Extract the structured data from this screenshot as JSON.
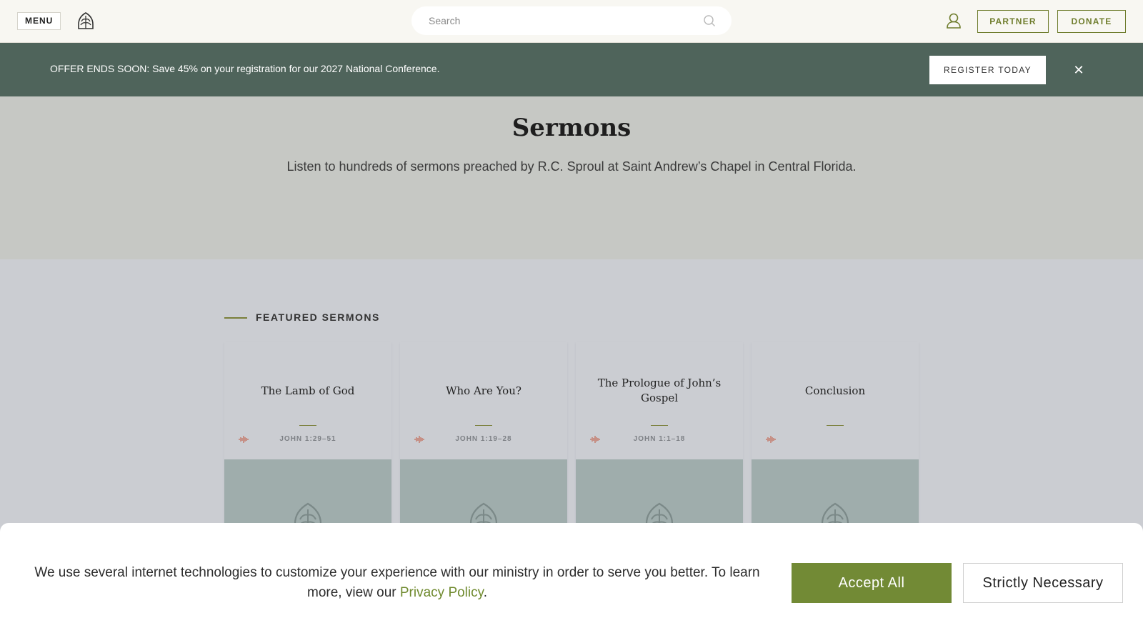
{
  "header": {
    "menu_label": "MENU",
    "logo_icon": "leaf-shield-icon",
    "search_placeholder": "Search",
    "search_icon": "search-icon",
    "user_icon": "user-icon",
    "partner_label": "PARTNER",
    "donate_label": "DONATE"
  },
  "promo": {
    "text": "OFFER ENDS SOON: Save 45% on your registration for our 2027 National Conference.",
    "register_label": "REGISTER TODAY",
    "close_icon": "close-icon",
    "close_glyph": "✕"
  },
  "hero": {
    "title": "Sermons",
    "subtitle": "Listen to hundreds of sermons preached by R.C. Sproul at Saint Andrew’s Chapel in Central Florida."
  },
  "featured": {
    "heading": "FEATURED SERMONS",
    "cards": [
      {
        "title": "The Lamb of God",
        "reference": "JOHN 1:29–51",
        "audio_icon": "audio-wave-icon"
      },
      {
        "title": "Who Are You?",
        "reference": "JOHN 1:19–28",
        "audio_icon": "audio-wave-icon"
      },
      {
        "title": "The Prologue of John’s Gospel",
        "reference": "JOHN 1:1–18",
        "audio_icon": "audio-wave-icon"
      },
      {
        "title": "Conclusion",
        "reference": "",
        "audio_icon": "audio-wave-icon"
      }
    ]
  },
  "cookie": {
    "text_before": "We use several internet technologies to customize your experience with our ministry in order to serve you better. To learn more, view our ",
    "link_text": "Privacy Policy",
    "text_after": ".",
    "accept_label": "Accept All",
    "necessary_label": "Strictly Necessary"
  },
  "colors": {
    "accent_olive": "#728a35",
    "banner_green": "#4f645b",
    "hero_bg": "#c6c8c4",
    "audio_red": "#c0523a"
  }
}
